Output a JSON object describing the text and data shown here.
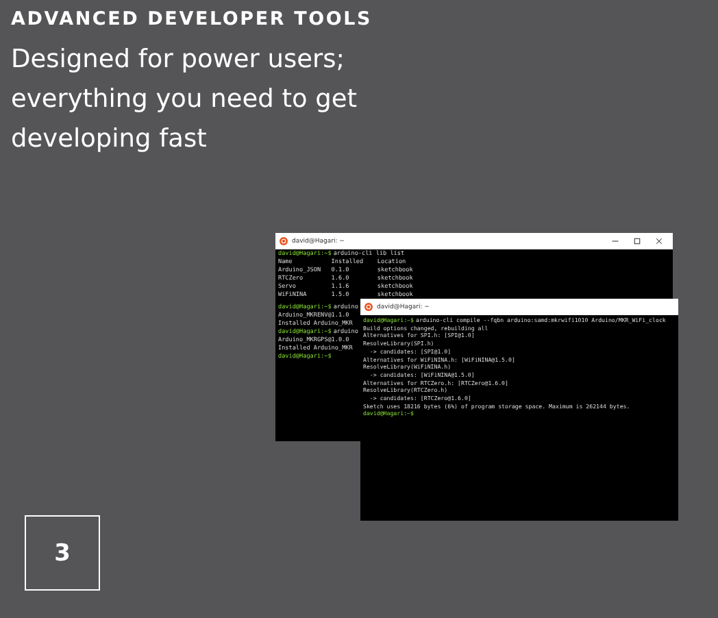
{
  "heading": "ADVANCED DEVELOPER TOOLS",
  "tagline": "Designed for power users; everything you need to get developing fast",
  "back_terminal": {
    "title": "david@Hagari: ~",
    "lines": [
      {
        "prompt": "david@Hagari:~$",
        "text": "arduino-cli lib list"
      },
      {
        "text": "Name           Installed    Location"
      },
      {
        "text": "Arduino_JSON   0.1.0        sketchbook"
      },
      {
        "text": "RTCZero        1.6.0        sketchbook"
      },
      {
        "text": "Servo          1.1.6        sketchbook"
      },
      {
        "text": "WiFiNINA       1.5.0        sketchbook"
      },
      {
        "kind": "blank"
      },
      {
        "prompt": "david@Hagari:~$",
        "text": "arduino"
      },
      {
        "text": "Arduino_MKRENV@1.1.0"
      },
      {
        "text": "Installed Arduino_MKR"
      },
      {
        "prompt": "david@Hagari:~$",
        "text": "arduino"
      },
      {
        "text": "Arduino_MKRGPS@1.0.0"
      },
      {
        "text": "Installed Arduino_MKR"
      },
      {
        "prompt": "david@Hagari:~$"
      }
    ]
  },
  "front_terminal": {
    "title": "david@Hagari: ~",
    "lines": [
      {
        "prompt": "david@Hagari:~$",
        "text": "arduino-cli compile --fqbn arduino:samd:mkrwifi1010 Arduino/MKR_WiFi_clock"
      },
      {
        "text": "Build options changed, rebuilding all"
      },
      {
        "text": "Alternatives for SPI.h: [SPI@1.0]"
      },
      {
        "text": "ResolveLibrary(SPI.h)"
      },
      {
        "text": "  -> candidates: [SPI@1.0]"
      },
      {
        "text": "Alternatives for WiFiNINA.h: [WiFiNINA@1.5.0]"
      },
      {
        "text": "ResolveLibrary(WiFiNINA.h)"
      },
      {
        "text": "  -> candidates: [WiFiNINA@1.5.0]"
      },
      {
        "text": "Alternatives for RTCZero.h: [RTCZero@1.6.0]"
      },
      {
        "text": "ResolveLibrary(RTCZero.h)"
      },
      {
        "text": "  -> candidates: [RTCZero@1.6.0]"
      },
      {
        "text": "Sketch uses 18216 bytes (6%) of program storage space. Maximum is 262144 bytes."
      },
      {
        "prompt": "david@Hagari:~$"
      }
    ]
  },
  "step_number": "3"
}
